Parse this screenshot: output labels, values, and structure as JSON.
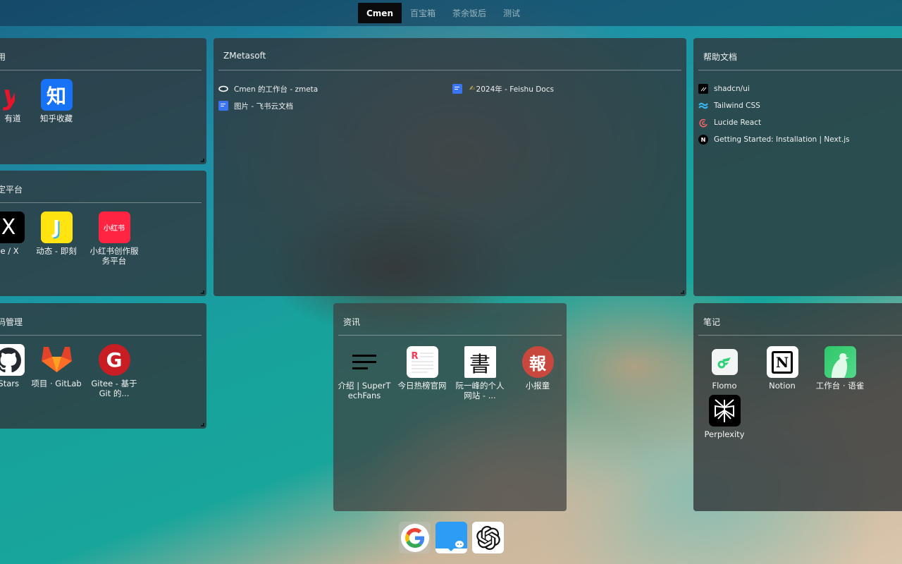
{
  "tabs": [
    {
      "label": "Cmen",
      "active": true
    },
    {
      "label": "百宝箱",
      "active": false
    },
    {
      "label": "茶余饭后",
      "active": false
    },
    {
      "label": "测试",
      "active": false
    }
  ],
  "panels": {
    "tools": {
      "title": "用",
      "apps": [
        {
          "label": "有道",
          "icon": "youdao-icon"
        },
        {
          "label": "知乎收藏",
          "icon": "zhihu-icon",
          "glyph": "知"
        }
      ]
    },
    "social": {
      "title": "定平台",
      "apps": [
        {
          "label": "me / X",
          "icon": "x-icon",
          "glyph": "X"
        },
        {
          "label": "动态 - 即刻",
          "icon": "jike-icon",
          "glyph": "J"
        },
        {
          "label": "小红书创作服务平台",
          "icon": "xiaohongshu-icon",
          "glyph": "小红书"
        }
      ]
    },
    "code": {
      "title": "码管理",
      "apps": [
        {
          "label": "r Stars",
          "icon": "github-icon"
        },
        {
          "label": "项目 · GitLab",
          "icon": "gitlab-icon"
        },
        {
          "label": "Gitee - 基于 Git 的...",
          "icon": "gitee-icon",
          "glyph": "G"
        }
      ]
    },
    "zmetasoft": {
      "title": "ZMetasoft",
      "links": [
        {
          "label": "Cmen 的工作台 - zmeta",
          "icon": "eye-icon"
        },
        {
          "label": "图片 - 飞书云文档",
          "icon": "feishu-doc-icon"
        }
      ],
      "links_col2": [
        {
          "label": "2024年 - Feishu Docs",
          "icon": "feishu-doc-icon",
          "emoji": "✍"
        }
      ]
    },
    "docs": {
      "title": "帮助文档",
      "links": [
        {
          "label": "shadcn/ui",
          "icon": "shadcn-icon"
        },
        {
          "label": "Tailwind CSS",
          "icon": "tailwind-icon"
        },
        {
          "label": "Lucide React",
          "icon": "lucide-icon"
        },
        {
          "label": "Getting Started: Installation | Next.js",
          "icon": "nextjs-icon",
          "glyph": "N"
        }
      ]
    },
    "news": {
      "title": "资讯",
      "apps": [
        {
          "label": "介绍 | SuperTechFans",
          "icon": "menu-lines-icon"
        },
        {
          "label": "今日热榜官网",
          "icon": "rebang-icon",
          "glyph": "R"
        },
        {
          "label": "阮一峰的个人网站 - ...",
          "icon": "ruanyifeng-icon",
          "glyph": "書"
        },
        {
          "label": "小报童",
          "icon": "xiaobaotong-icon",
          "glyph": "報"
        }
      ]
    },
    "notes": {
      "title": "笔记",
      "apps": [
        {
          "label": "Flomo",
          "icon": "flomo-icon"
        },
        {
          "label": "Notion",
          "icon": "notion-icon",
          "glyph": "N"
        },
        {
          "label": "工作台 · 语雀",
          "icon": "yuque-icon"
        },
        {
          "label": "Perplexity",
          "icon": "perplexity-icon"
        }
      ]
    }
  },
  "dock": [
    {
      "name": "google",
      "icon": "google-icon",
      "glyph": "G"
    },
    {
      "name": "chat",
      "icon": "chat-book-icon"
    },
    {
      "name": "chatgpt",
      "icon": "openai-icon"
    }
  ],
  "colors": {
    "youdao": "#e8142b",
    "zhihu": "#1772f6",
    "jike": "#ffe411",
    "xiaohongshu": "#ff2442",
    "gitlab": "#fc6d26",
    "gitee": "#c71d23",
    "feishu_doc": "#3b74f0",
    "flomo": "#30cf79",
    "yuque": "#31cc76",
    "tailwind": "#38bdf8",
    "lucide": "#f56565"
  }
}
